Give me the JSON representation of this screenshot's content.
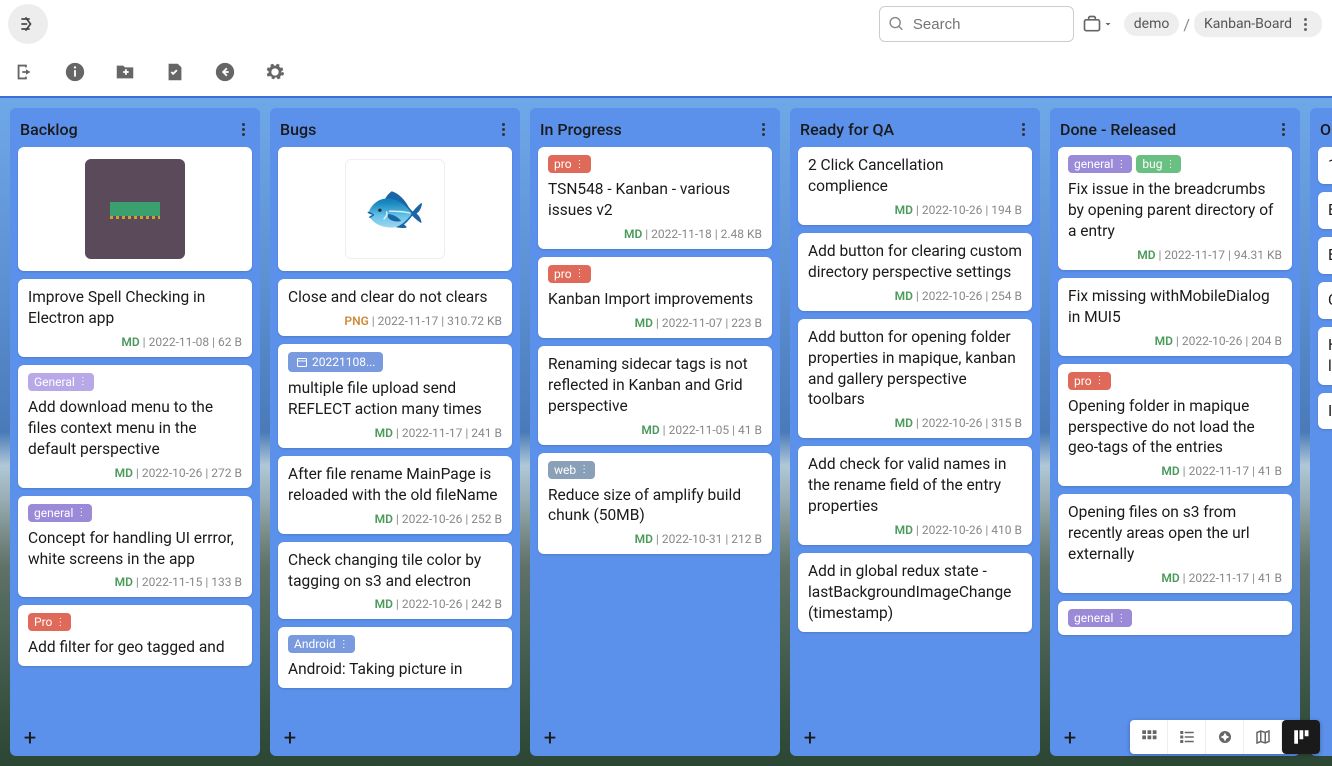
{
  "search": {
    "placeholder": "Search"
  },
  "breadcrumb": {
    "root": "demo",
    "current": "Kanban-Board"
  },
  "columns": [
    {
      "title": "Backlog",
      "has_image": "purple",
      "image_alt": "ram-chip",
      "cards": [
        {
          "title": "Improve Spell Checking in Electron app",
          "ext": "MD",
          "date": "2022-11-08",
          "size": "62 B"
        },
        {
          "tags": [
            {
              "label": "General",
              "cls": "tag-general-l"
            }
          ],
          "title": "Add download menu to the files context menu in the default perspective",
          "ext": "MD",
          "date": "2022-10-26",
          "size": "272 B"
        },
        {
          "tags": [
            {
              "label": "general",
              "cls": "tag-general"
            }
          ],
          "title": "Concept for handling UI errror, white screens in the app",
          "ext": "MD",
          "date": "2022-11-15",
          "size": "133 B"
        },
        {
          "tags": [
            {
              "label": "Pro",
              "cls": "tag-pro"
            }
          ],
          "title": "Add filter for geo tagged and",
          "ext": "",
          "date": "",
          "size": ""
        }
      ]
    },
    {
      "title": "Bugs",
      "has_image": "white",
      "image_alt": "fish",
      "cards": [
        {
          "title": "Close and clear do not clears",
          "ext": "PNG",
          "date": "2022-11-17",
          "size": "310.72 KB"
        },
        {
          "datetag": "20221108...",
          "title": "multiple file upload send REFLECT action many times",
          "ext": "MD",
          "date": "2022-11-17",
          "size": "241 B"
        },
        {
          "title": "After file rename MainPage is reloaded with the old fileName",
          "ext": "MD",
          "date": "2022-10-26",
          "size": "252 B"
        },
        {
          "title": "Check changing tile color by tagging on s3 and electron",
          "ext": "MD",
          "date": "2022-10-26",
          "size": "242 B"
        },
        {
          "tags": [
            {
              "label": "Android",
              "cls": "tag-android"
            }
          ],
          "title": "Android: Taking picture in",
          "ext": "",
          "date": "",
          "size": ""
        }
      ]
    },
    {
      "title": "In Progress",
      "cards": [
        {
          "tags": [
            {
              "label": "pro",
              "cls": "tag-pro"
            }
          ],
          "title": "TSN548 - Kanban - various issues v2",
          "ext": "MD",
          "date": "2022-11-18",
          "size": "2.48 KB"
        },
        {
          "tags": [
            {
              "label": "pro",
              "cls": "tag-pro"
            }
          ],
          "title": "Kanban Import improvements",
          "ext": "MD",
          "date": "2022-11-07",
          "size": "223 B"
        },
        {
          "title": "Renaming sidecar tags is not reflected in Kanban and Grid perspective",
          "ext": "MD",
          "date": "2022-11-05",
          "size": "41 B"
        },
        {
          "tags": [
            {
              "label": "web",
              "cls": "tag-web"
            }
          ],
          "title": "Reduce size of amplify build chunk (50MB)",
          "ext": "MD",
          "date": "2022-10-31",
          "size": "212 B"
        }
      ]
    },
    {
      "title": "Ready for QA",
      "cards": [
        {
          "title": "2 Click Cancellation complience",
          "ext": "MD",
          "date": "2022-10-26",
          "size": "194 B"
        },
        {
          "title": "Add button for clearing custom directory perspective settings",
          "ext": "MD",
          "date": "2022-10-26",
          "size": "254 B"
        },
        {
          "title": "Add button for opening folder properties in mapique, kanban and gallery perspective toolbars",
          "ext": "MD",
          "date": "2022-10-26",
          "size": "315 B"
        },
        {
          "title": "Add check for valid names in the rename field of the entry properties",
          "ext": "MD",
          "date": "2022-10-26",
          "size": "410 B"
        },
        {
          "title": "Add in global redux state - lastBackgroundImageChange (timestamp)",
          "ext": "",
          "date": "",
          "size": ""
        }
      ]
    },
    {
      "title": "Done - Released",
      "cards": [
        {
          "tags": [
            {
              "label": "general",
              "cls": "tag-general"
            },
            {
              "label": "bug",
              "cls": "tag-bug"
            }
          ],
          "title": "Fix issue in the breadcrumbs by opening parent directory of a entry",
          "ext": "MD",
          "date": "2022-11-17",
          "size": "94.31 KB"
        },
        {
          "title": "Fix missing withMobileDialog in MUI5",
          "ext": "MD",
          "date": "2022-10-26",
          "size": "204 B"
        },
        {
          "tags": [
            {
              "label": "pro",
              "cls": "tag-pro"
            }
          ],
          "title": "Opening folder in mapique perspective do not load the geo-tags of the entries",
          "ext": "MD",
          "date": "2022-11-17",
          "size": "41 B"
        },
        {
          "title": "Opening files on s3 from recently areas open the url externally",
          "ext": "MD",
          "date": "2022-11-17",
          "size": "41 B"
        },
        {
          "tags": [
            {
              "label": "general",
              "cls": "tag-general"
            }
          ],
          "title": "",
          "ext": "",
          "date": "",
          "size": ""
        }
      ]
    },
    {
      "title": "O",
      "partial": true,
      "cards": [
        {
          "title": "1",
          "ext": "",
          "date": "",
          "size": ""
        },
        {
          "title": "E",
          "ext": "",
          "date": "",
          "size": ""
        },
        {
          "title": "E",
          "ext": "",
          "date": "",
          "size": ""
        },
        {
          "title": "C",
          "ext": "",
          "date": "",
          "size": ""
        },
        {
          "title": "H li",
          "ext": "",
          "date": "",
          "size": ""
        },
        {
          "title": "I",
          "ext": "",
          "date": "",
          "size": ""
        }
      ]
    }
  ]
}
